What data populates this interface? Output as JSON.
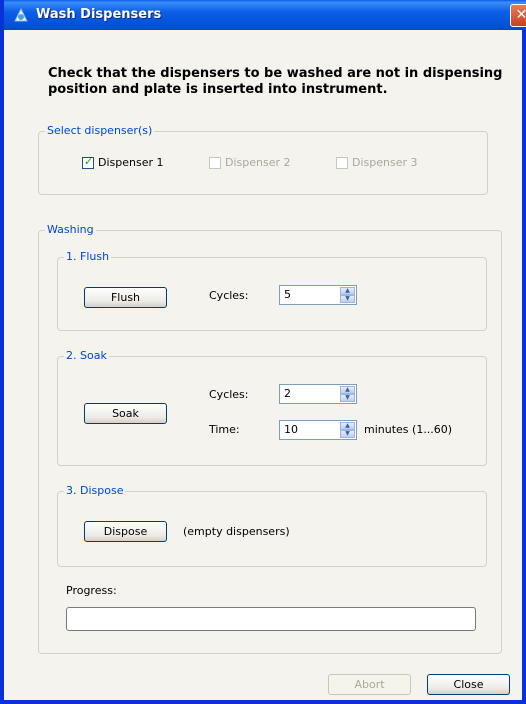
{
  "window": {
    "title": "Wash Dispensers",
    "close_glyph": "✕"
  },
  "instructions": "Check that the dispensers to be washed are not in dispensing position and plate is inserted into instrument.",
  "select_dispensers": {
    "legend": "Select dispenser(s)",
    "items": [
      {
        "label": "Dispenser 1",
        "checked": true,
        "enabled": true
      },
      {
        "label": "Dispenser 2",
        "checked": false,
        "enabled": false
      },
      {
        "label": "Dispenser 3",
        "checked": false,
        "enabled": false
      }
    ]
  },
  "washing": {
    "legend": "Washing",
    "flush": {
      "legend": "1. Flush",
      "button": "Flush",
      "cycles_label": "Cycles:",
      "cycles_value": "5"
    },
    "soak": {
      "legend": "2. Soak",
      "button": "Soak",
      "cycles_label": "Cycles:",
      "cycles_value": "2",
      "time_label": "Time:",
      "time_value": "10",
      "time_unit": "minutes (1...60)"
    },
    "dispose": {
      "legend": "3. Dispose",
      "button": "Dispose",
      "note": "(empty dispensers)"
    },
    "progress_label": "Progress:",
    "progress_percent": 0
  },
  "footer": {
    "abort_label": "Abort",
    "close_label": "Close"
  },
  "colors": {
    "title_bar": "#0a5fe8",
    "legend_text": "#0046d5",
    "check_mark": "#21a121"
  }
}
